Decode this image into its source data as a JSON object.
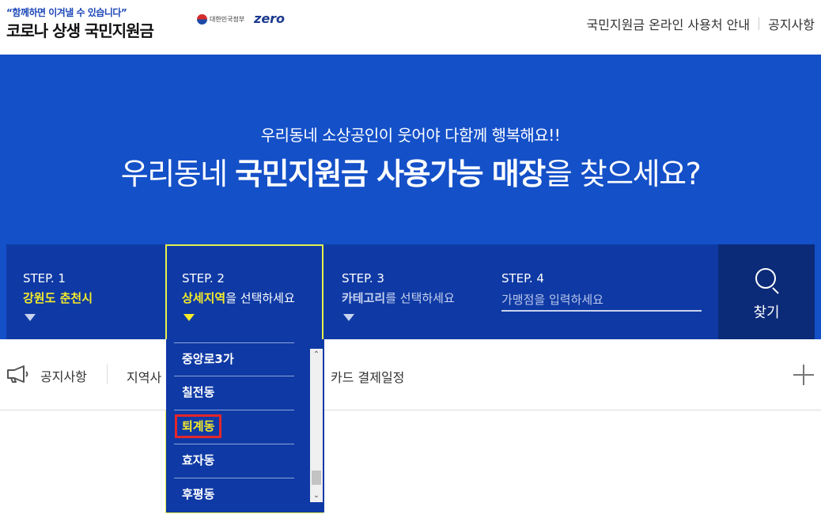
{
  "header": {
    "tagline": "“함께하면 이겨낼 수 있습니다”",
    "title": "코로나 상생 국민지원금",
    "gov_text": "대한민국정부",
    "zero_text": "zero",
    "links": [
      "국민지원금 온라인 사용처 안내",
      "공지사항"
    ]
  },
  "hero": {
    "subtitle": "우리동네 소상공인이 웃어야 다함께 행복해요!!",
    "title_prefix": "우리동네 ",
    "title_bold": "국민지원금 사용가능 매장",
    "title_suffix": "을 찾으세요?"
  },
  "steps": [
    {
      "label": "STEP. 1",
      "value_hl": "강원도 춘천시",
      "value_rest": ""
    },
    {
      "label": "STEP. 2",
      "value_hl": "상세지역",
      "value_rest": "을 선택하세요"
    },
    {
      "label": "STEP. 3",
      "value_hl": "카테고리",
      "value_rest": "를 선택하세요"
    },
    {
      "label": "STEP. 4",
      "placeholder": "가맹점을 입력하세요"
    }
  ],
  "search_label": "찾기",
  "dropdown": {
    "items": [
      "중앙로3가",
      "칠전동",
      "퇴계동",
      "효자동",
      "후평동"
    ],
    "selected": "퇴계동"
  },
  "notice": {
    "label": "공지사항",
    "text1": "지역사",
    "text2": "카드 결제일정"
  }
}
